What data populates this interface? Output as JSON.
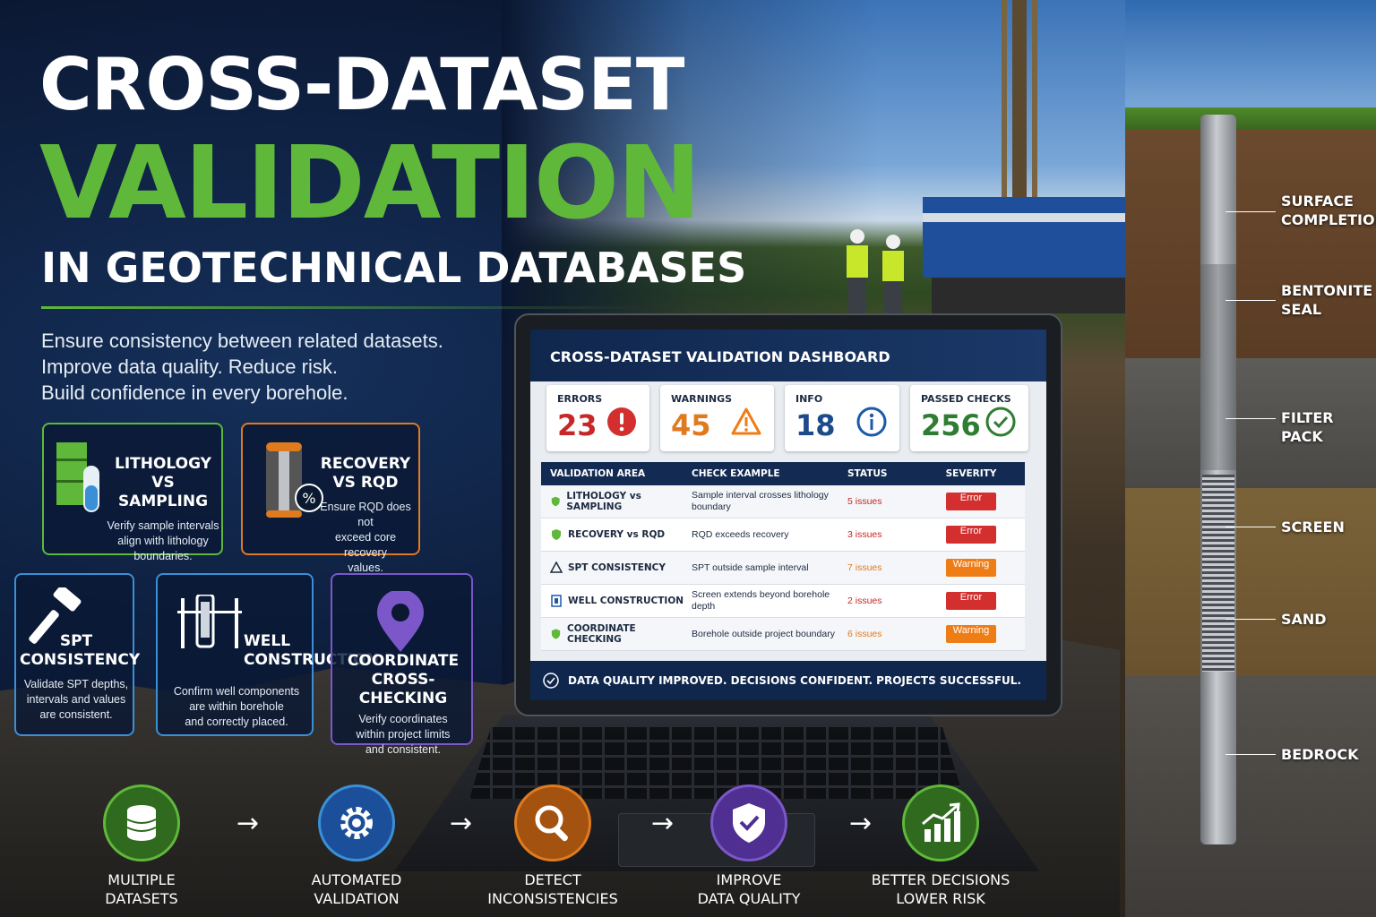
{
  "header": {
    "title_line1": "CROSS-DATASET",
    "title_line2": "VALIDATION",
    "title_line3": "IN GEOTECHNICAL DATABASES",
    "tagline": [
      "Ensure consistency between related datasets.",
      "Improve data quality. Reduce risk.",
      "Build confidence in every borehole."
    ]
  },
  "colors": {
    "green": "#5fb83a",
    "orange": "#e07a1f",
    "blue": "#3b8fd6",
    "purple": "#7b57c9",
    "navy": "#10274d",
    "error": "#d32f2f",
    "warning": "#ef7d16"
  },
  "cards": [
    {
      "title": "LITHOLOGY\nVS SAMPLING",
      "desc": "Verify sample intervals\nalign with lithology\nboundaries.",
      "icon": "lithology-sampling-icon"
    },
    {
      "title": "RECOVERY\nVS RQD",
      "desc": "Ensure RQD does not\nexceed core recovery\nvalues.",
      "icon": "core-recovery-icon"
    },
    {
      "title": "SPT\nCONSISTENCY",
      "desc": "Validate SPT depths,\nintervals and values\nare consistent.",
      "icon": "hammer-icon"
    },
    {
      "title": "WELL\nCONSTRUCTION",
      "desc": "Confirm well components\nare within borehole\nand correctly placed.",
      "icon": "well-construction-icon"
    },
    {
      "title": "COORDINATE\nCROSS-CHECKING",
      "desc": "Verify coordinates\nwithin project limits\nand consistent.",
      "icon": "map-pin-icon"
    }
  ],
  "dashboard": {
    "title": "CROSS-DATASET VALIDATION DASHBOARD",
    "kpis": [
      {
        "label": "ERRORS",
        "value": "23",
        "icon": "exclamation-circle-icon"
      },
      {
        "label": "WARNINGS",
        "value": "45",
        "icon": "warning-triangle-icon"
      },
      {
        "label": "INFO",
        "value": "18",
        "icon": "info-circle-icon"
      },
      {
        "label": "PASSED CHECKS",
        "value": "256",
        "icon": "check-circle-icon"
      }
    ],
    "columns": [
      "VALIDATION AREA",
      "CHECK EXAMPLE",
      "STATUS",
      "SEVERITY"
    ],
    "rows": [
      {
        "area": "LITHOLOGY vs SAMPLING",
        "check": "Sample interval crosses lithology boundary",
        "status": "5 issues",
        "severity": "Error"
      },
      {
        "area": "RECOVERY vs RQD",
        "check": "RQD exceeds recovery",
        "status": "3 issues",
        "severity": "Error"
      },
      {
        "area": "SPT CONSISTENCY",
        "check": "SPT outside sample interval",
        "status": "7 issues",
        "severity": "Warning"
      },
      {
        "area": "WELL CONSTRUCTION",
        "check": "Screen extends beyond borehole depth",
        "status": "2 issues",
        "severity": "Error"
      },
      {
        "area": "COORDINATE CHECKING",
        "check": "Borehole outside project boundary",
        "status": "6 issues",
        "severity": "Warning"
      }
    ],
    "footer": "DATA QUALITY IMPROVED. DECISIONS CONFIDENT. PROJECTS SUCCESSFUL."
  },
  "well": {
    "labels": [
      "SURFACE\nCOMPLETION",
      "BENTONITE\nSEAL",
      "FILTER PACK",
      "SCREEN",
      "SAND",
      "BEDROCK"
    ]
  },
  "flow": [
    {
      "label": "MULTIPLE\nDATASETS",
      "icon": "database-icon"
    },
    {
      "label": "AUTOMATED\nVALIDATION",
      "icon": "gear-icon"
    },
    {
      "label": "DETECT\nINCONSISTENCIES",
      "icon": "magnifier-icon"
    },
    {
      "label": "IMPROVE\nDATA QUALITY",
      "icon": "shield-check-icon"
    },
    {
      "label": "BETTER DECISIONS\nLOWER RISK",
      "icon": "growth-chart-icon"
    }
  ]
}
